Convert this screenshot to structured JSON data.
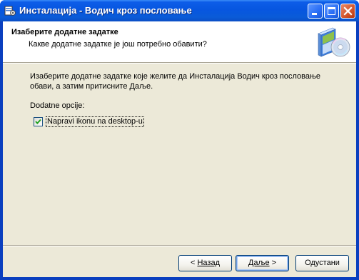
{
  "window": {
    "title": "Инсталација - Водич кроз пословање"
  },
  "header": {
    "title": "Изаберите додатне задатке",
    "subtitle": "Какве додатне задатке је још потребно обавити?"
  },
  "body": {
    "description": "Изаберите додатне задатке које желите да Инсталација Водич кроз пословање обави, а затим притисните Даље.",
    "options_label": "Dodatne opcije:",
    "options": [
      {
        "label": "Napravi ikonu na desktop-u",
        "checked": true
      }
    ]
  },
  "buttons": {
    "back_prefix": "< ",
    "back_label": "Назад",
    "next_label": "Даље",
    "next_suffix": " >",
    "cancel_label": "Одустани"
  },
  "icons": {
    "app": "installer-icon",
    "wizard": "software-box-cd-icon"
  },
  "colors": {
    "titlebar": "#0756e0",
    "client_bg": "#ece9d8",
    "close_button": "#d2542a"
  }
}
